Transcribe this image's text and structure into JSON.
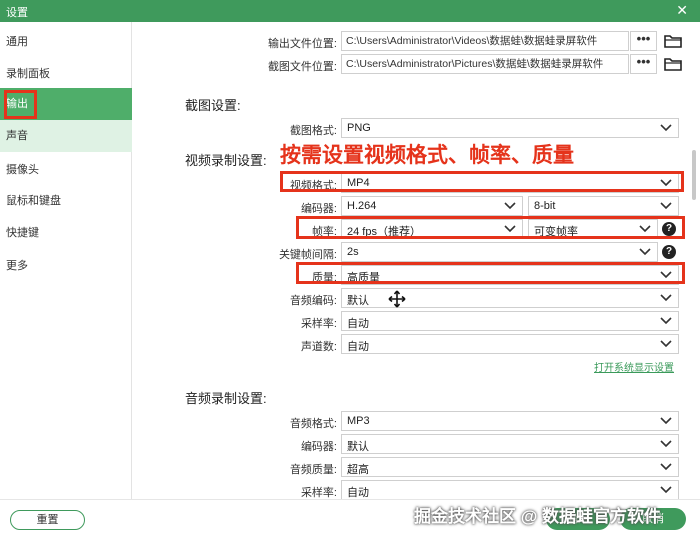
{
  "window": {
    "title": "设置",
    "close": "✕"
  },
  "sidebar": {
    "items": [
      {
        "label": "通用"
      },
      {
        "label": "录制面板"
      },
      {
        "label": "输出"
      },
      {
        "label": "声音"
      },
      {
        "label": "摄像头"
      },
      {
        "label": "鼠标和键盘"
      },
      {
        "label": "快捷键"
      },
      {
        "label": "更多"
      }
    ],
    "active_index": 2
  },
  "output": {
    "video_path_label": "输出文件位置:",
    "video_path": "C:\\Users\\Administrator\\Videos\\数据蛙\\数据蛙录屏软件",
    "image_path_label": "截图文件位置:",
    "image_path": "C:\\Users\\Administrator\\Pictures\\数据蛙\\数据蛙录屏软件",
    "browse_label": "•••"
  },
  "screenshot_settings": {
    "title": "截图设置:",
    "format_label": "截图格式:",
    "format_value": "PNG"
  },
  "video_settings": {
    "title": "视频录制设置:",
    "format_label": "视频格式:",
    "format_value": "MP4",
    "encoder_label": "编码器:",
    "encoder_value": "H.264",
    "bitdepth_value": "8-bit",
    "framerate_label": "帧率:",
    "framerate_value": "24 fps（推荐）",
    "framerate_mode_value": "可变帧率",
    "keyframe_label": "关键帧间隔:",
    "keyframe_value": "2s",
    "quality_label": "质量:",
    "quality_value": "高质量",
    "audio_codec_label": "音频编码:",
    "audio_codec_value": "默认",
    "samplerate_label": "采样率:",
    "samplerate_value": "自动",
    "channels_label": "声道数:",
    "channels_value": "自动",
    "display_settings_link": "打开系统显示设置",
    "help_symbol": "?"
  },
  "audio_settings": {
    "title": "音频录制设置:",
    "format_label": "音频格式:",
    "format_value": "MP3",
    "encoder_label": "编码器:",
    "encoder_value": "默认",
    "quality_label": "音频质量:",
    "quality_value": "超高",
    "samplerate_label": "采样率:",
    "samplerate_value": "自动"
  },
  "annotation": {
    "text": "按需设置视频格式、帧率、质量",
    "color": "#e5331b"
  },
  "footer": {
    "reset_label": "重置",
    "ok_label": "确定",
    "cancel_label": "取消"
  },
  "watermark": "掘金技术社区 @ 数据蛙官方软件",
  "colors": {
    "accent": "#3f9a5c",
    "active_item": "#4fae6a",
    "hover_item": "#dff2e4",
    "highlight": "#e5331b"
  }
}
